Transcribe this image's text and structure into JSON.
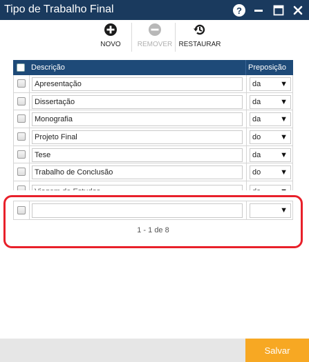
{
  "window": {
    "title": "Tipo de Trabalho Final",
    "title_bar_color": "#1a3a5e"
  },
  "toolbar": {
    "novo_label": "NOVO",
    "remover_label": "REMOVER",
    "restaurar_label": "RESTAURAR",
    "novo_icon": "plus-circle-icon",
    "remover_icon": "minus-circle-icon",
    "restaurar_icon": "restore-history-icon"
  },
  "grid": {
    "header_color": "#1e4a78",
    "columns": {
      "descricao": "Descrição",
      "preposicao": "Preposição"
    },
    "rows": [
      {
        "descricao": "Apresentação",
        "preposicao": "da"
      },
      {
        "descricao": "Dissertação",
        "preposicao": "da"
      },
      {
        "descricao": "Monografia",
        "preposicao": "da"
      },
      {
        "descricao": "Projeto Final",
        "preposicao": "do"
      },
      {
        "descricao": "Tese",
        "preposicao": "da"
      },
      {
        "descricao": "Trabalho de Conclusão",
        "preposicao": "do"
      },
      {
        "descricao": "Viagem de Estudos",
        "preposicao": "da"
      }
    ],
    "new_row": {
      "descricao": "",
      "preposicao": ""
    },
    "pager": "1 - 1 de 8"
  },
  "footer": {
    "save_label": "Salvar",
    "save_color": "#f7a823"
  },
  "annotation": {
    "highlight_color": "#e8202a"
  }
}
